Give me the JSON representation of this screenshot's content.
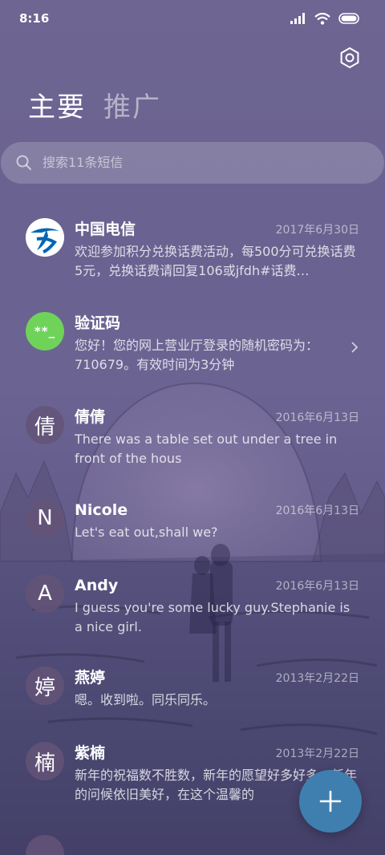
{
  "status_bar": {
    "time": "8:16",
    "icons": [
      "signal-icon",
      "wifi-icon",
      "battery-icon"
    ]
  },
  "header": {
    "settings_icon": "gear-icon",
    "tabs": [
      {
        "label": "主要",
        "active": true
      },
      {
        "label": "推广",
        "active": false
      }
    ]
  },
  "search": {
    "placeholder": "搜索11条短信",
    "icon": "search-icon"
  },
  "conversations": [
    {
      "name": "中国电信",
      "date": "2017年6月30日",
      "preview": "欢迎参加积分兑换话费活动，每500分可兑换话费5元，兑换话费请回复106或jfdh#话费…",
      "avatar": {
        "type": "logo",
        "icon": "china-telecom-logo-icon",
        "color": "#0066b3"
      }
    },
    {
      "name": "验证码",
      "date": "",
      "preview": "您好！您的网上营业厅登录的随机密码为：710679。有效时间为3分钟",
      "avatar": {
        "type": "text",
        "text": "**_",
        "color": "#6fd35a"
      },
      "has_chevron": true
    },
    {
      "name": "倩倩",
      "date": "2016年6月13日",
      "preview": "There was a table set out under a tree in front of the hous",
      "avatar": {
        "type": "letter",
        "text": "倩"
      }
    },
    {
      "name": "Nicole",
      "date": "2016年6月13日",
      "preview": "Let's eat out,shall we?",
      "avatar": {
        "type": "letter",
        "text": "N"
      }
    },
    {
      "name": "Andy",
      "date": "2016年6月13日",
      "preview": "I guess you're some lucky guy.Stephanie is a nice girl.",
      "avatar": {
        "type": "letter",
        "text": "A"
      }
    },
    {
      "name": "燕婷",
      "date": "2013年2月22日",
      "preview": "嗯。收到啦。同乐同乐。",
      "avatar": {
        "type": "letter",
        "text": "婷"
      }
    },
    {
      "name": "紫楠",
      "date": "2013年2月22日",
      "preview": "新年的祝福数不胜数，新年的愿望好多好多，新年的问候依旧美好，在这个温馨的",
      "avatar": {
        "type": "letter",
        "text": "楠"
      }
    }
  ],
  "fab": {
    "icon": "plus-icon",
    "color": "#3f7fb0"
  }
}
